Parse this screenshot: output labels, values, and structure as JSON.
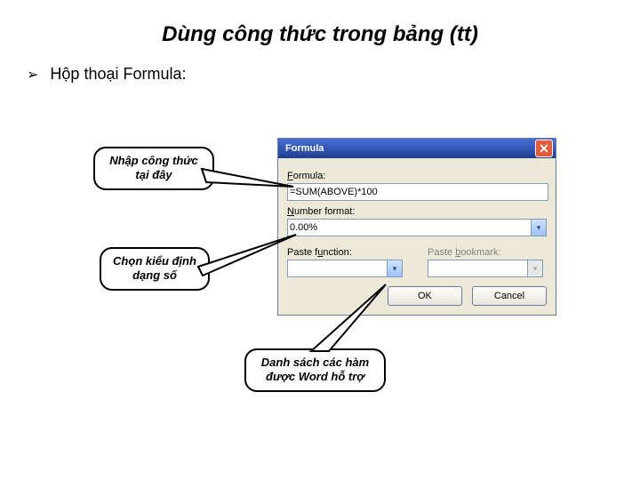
{
  "title": "Dùng công thức trong bảng (tt)",
  "bullet": {
    "marker": "➢",
    "text": "Hộp thoại Formula:"
  },
  "dialog": {
    "titlebar_text": "Formula",
    "close_glyph": "✕",
    "labels": {
      "formula_prefix": "F",
      "formula_rest": "ormula:",
      "number_prefix": "N",
      "number_rest": "umber format:",
      "paste_func_prefix": "Paste f",
      "paste_func_u": "u",
      "paste_func_rest": "nction:",
      "paste_bookmark_prefix": "Paste ",
      "paste_bookmark_u": "b",
      "paste_bookmark_rest": "ookmark:"
    },
    "values": {
      "formula": "=SUM(ABOVE)*100",
      "number_format": "0.00%",
      "paste_function": "",
      "paste_bookmark": ""
    },
    "dropdown_glyph": "▾",
    "buttons": {
      "ok": "OK",
      "cancel": "Cancel"
    }
  },
  "callouts": {
    "c1": "Nhập công thức tại đây",
    "c2": "Chọn kiểu định dạng số",
    "c3": "Danh sách các hàm được Word hỗ trợ"
  }
}
